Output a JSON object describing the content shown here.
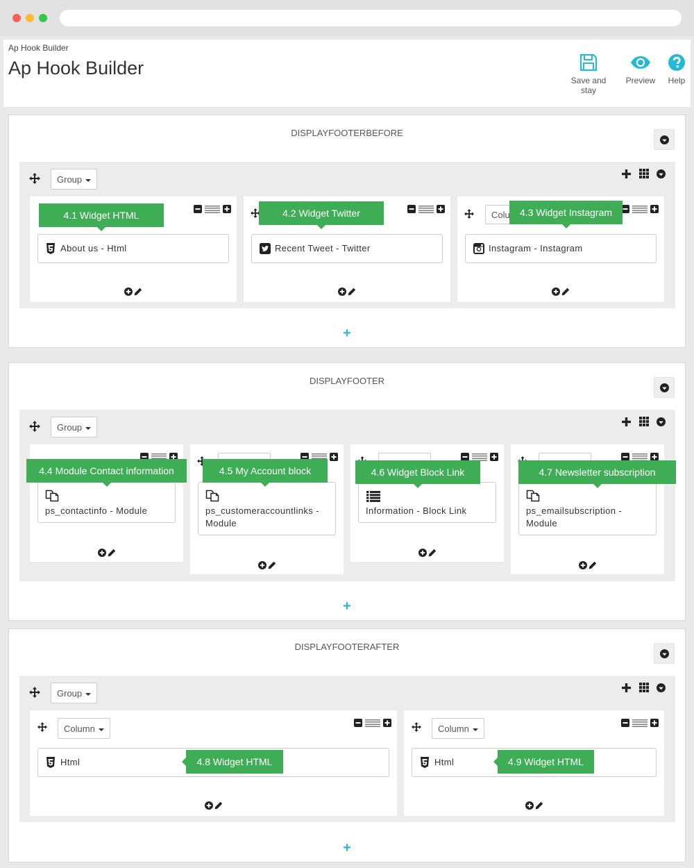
{
  "window": {
    "title": ""
  },
  "header": {
    "breadcrumb": "Ap Hook Builder",
    "title": "Ap Hook Builder",
    "toolbar": {
      "save": "Save and stay",
      "preview": "Preview",
      "help": "Help"
    }
  },
  "colors": {
    "accent": "#25b9d7",
    "callout": "#3fad56"
  },
  "hooks": [
    {
      "name": "DISPLAYFOOTERBEFORE",
      "group_label": "Group",
      "add_label": "+",
      "columns": [
        {
          "column_label": "",
          "widget": "About us - Html",
          "icon": "html5-icon",
          "callout": "4.1 Widget HTML"
        },
        {
          "column_label": "",
          "widget": "Recent Tweet - Twitter",
          "icon": "twitter-icon",
          "callout": "4.2 Widget Twitter"
        },
        {
          "column_label": "Colu",
          "widget": "Instagram - Instagram",
          "icon": "instagram-icon",
          "callout": "4.3 Widget Instagram"
        }
      ]
    },
    {
      "name": "DISPLAYFOOTER",
      "group_label": "Group",
      "add_label": "+",
      "columns": [
        {
          "widget": "ps_contactinfo - Module",
          "icon": "module-icon",
          "callout": "4.4 Module Contact information"
        },
        {
          "widget": "ps_customeraccountlinks - Module",
          "icon": "module-icon",
          "callout": "4.5 My Account block"
        },
        {
          "widget": "Information - Block Link",
          "icon": "list-icon",
          "callout": "4.6 Widget Block Link"
        },
        {
          "widget": "ps_emailsubscription - Module",
          "icon": "module-icon",
          "callout": "4.7 Newsletter subscription"
        }
      ]
    },
    {
      "name": "DISPLAYFOOTERAFTER",
      "group_label": "Group",
      "add_label": "+",
      "columns": [
        {
          "column_label": "Column",
          "widget": "Html",
          "icon": "html5-icon",
          "callout": "4.8 Widget HTML"
        },
        {
          "column_label": "Column",
          "widget": "Html",
          "icon": "html5-icon",
          "callout": "4.9 Widget HTML"
        }
      ]
    }
  ]
}
